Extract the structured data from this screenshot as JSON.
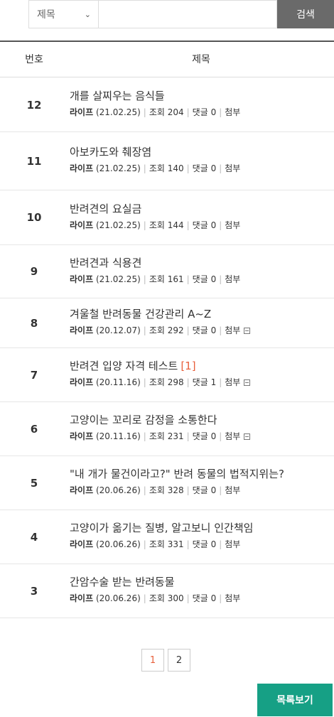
{
  "search": {
    "field_selected": "제목",
    "button_label": "검색"
  },
  "table": {
    "header_number": "번호",
    "header_title": "제목"
  },
  "posts": [
    {
      "number": "12",
      "title": "개를 살찌우는 음식들",
      "comments_badge": "",
      "category": "라이프",
      "date": "(21.02.25)",
      "views": "조회 204",
      "comments": "댓글 0",
      "attachment": "첨부",
      "has_file_icon": false
    },
    {
      "number": "11",
      "title": "아보카도와 췌장염",
      "comments_badge": "",
      "category": "라이프",
      "date": "(21.02.25)",
      "views": "조회 140",
      "comments": "댓글 0",
      "attachment": "첨부",
      "has_file_icon": false
    },
    {
      "number": "10",
      "title": "반려견의 요실금",
      "comments_badge": "",
      "category": "라이프",
      "date": "(21.02.25)",
      "views": "조회 144",
      "comments": "댓글 0",
      "attachment": "첨부",
      "has_file_icon": false
    },
    {
      "number": "9",
      "title": "반려견과 식용견",
      "comments_badge": "",
      "category": "라이프",
      "date": "(21.02.25)",
      "views": "조회 161",
      "comments": "댓글 0",
      "attachment": "첨부",
      "has_file_icon": false
    },
    {
      "number": "8",
      "title": "겨울철 반려동물 건강관리 A~Z",
      "comments_badge": "",
      "category": "라이프",
      "date": "(20.12.07)",
      "views": "조회 292",
      "comments": "댓글 0",
      "attachment": "첨부",
      "has_file_icon": true
    },
    {
      "number": "7",
      "title": "반려견 입양 자격 테스트",
      "comments_badge": "[1]",
      "category": "라이프",
      "date": "(20.11.16)",
      "views": "조회 298",
      "comments": "댓글 1",
      "attachment": "첨부",
      "has_file_icon": true
    },
    {
      "number": "6",
      "title": "고양이는 꼬리로 감정을 소통한다",
      "comments_badge": "",
      "category": "라이프",
      "date": "(20.11.16)",
      "views": "조회 231",
      "comments": "댓글 0",
      "attachment": "첨부",
      "has_file_icon": true
    },
    {
      "number": "5",
      "title": "\"내 개가 물건이라고?\" 반려 동물의 법적지위는?",
      "comments_badge": "",
      "category": "라이프",
      "date": "(20.06.26)",
      "views": "조회 328",
      "comments": "댓글 0",
      "attachment": "첨부",
      "has_file_icon": false
    },
    {
      "number": "4",
      "title": "고양이가 옮기는 질병, 알고보니 인간책임",
      "comments_badge": "",
      "category": "라이프",
      "date": "(20.06.26)",
      "views": "조회 331",
      "comments": "댓글 0",
      "attachment": "첨부",
      "has_file_icon": false
    },
    {
      "number": "3",
      "title": "간암수술 받는 반려동물",
      "comments_badge": "",
      "category": "라이프",
      "date": "(20.06.26)",
      "views": "조회 300",
      "comments": "댓글 0",
      "attachment": "첨부",
      "has_file_icon": false
    }
  ],
  "pagination": {
    "pages": [
      "1",
      "2"
    ],
    "current_page": "1"
  },
  "list_button_label": "목록보기",
  "colors": {
    "accent_green": "#16a085",
    "highlight_orange": "#e8603c",
    "search_button_gray": "#6a6a6a"
  }
}
